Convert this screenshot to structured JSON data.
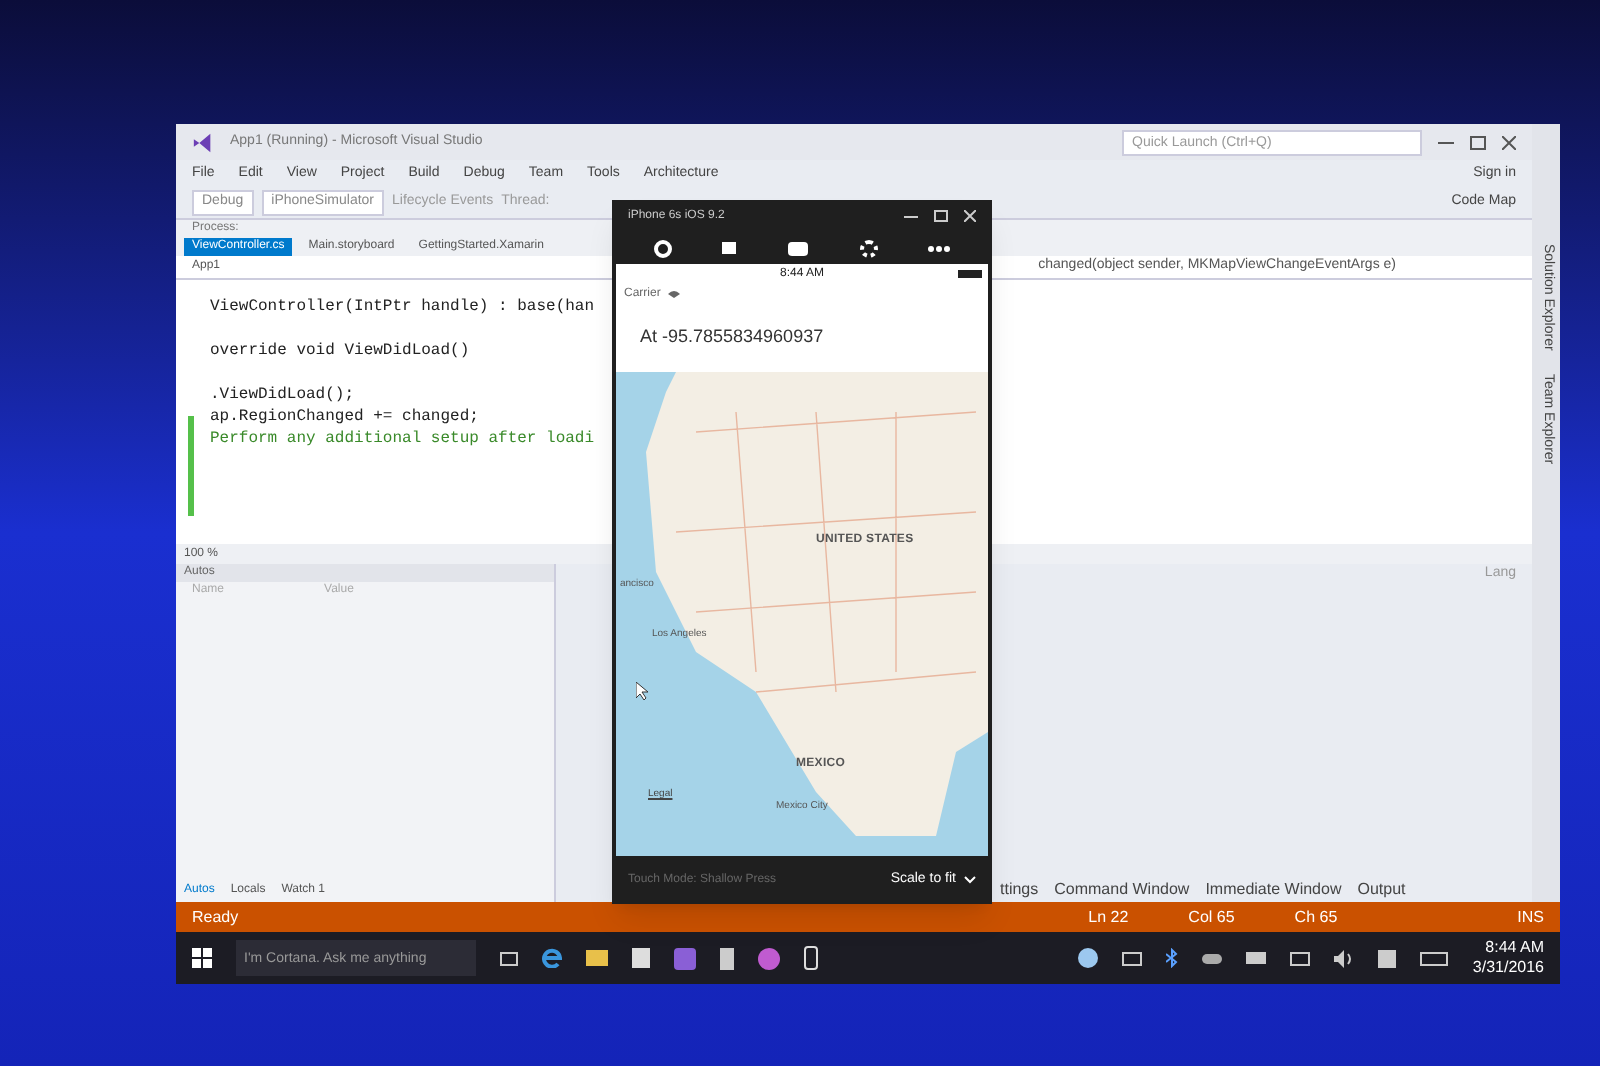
{
  "vs": {
    "title": "App1 (Running) - Microsoft Visual Studio",
    "quick_launch": {
      "placeholder": "Quick Launch (Ctrl+Q)"
    },
    "sign_in": "Sign in",
    "menu": [
      "File",
      "Edit",
      "View",
      "Project",
      "Build",
      "Debug",
      "Team",
      "Tools",
      "Architecture"
    ],
    "toolbar": {
      "configuration": "Debug",
      "platform": "iPhoneSimulator",
      "lifecycle": "Lifecycle Events",
      "thread": "Thread:",
      "process": "Process:",
      "code_map": "Code Map"
    },
    "tabs": [
      {
        "label": "ViewController.cs",
        "selected": true
      },
      {
        "label": "Main.storyboard",
        "selected": false
      },
      {
        "label": "GettingStarted.Xamarin",
        "selected": false
      }
    ],
    "nav": {
      "left": "App1",
      "right": "changed(object sender, MKMapViewChangeEventArgs e)"
    },
    "code": [
      {
        "kind": "plain",
        "text": "ViewController(IntPtr handle) : base(han"
      },
      {
        "kind": "blank"
      },
      {
        "kind": "plain",
        "text": "override void ViewDidLoad()"
      },
      {
        "kind": "blank"
      },
      {
        "kind": "plain",
        "text": ".ViewDidLoad();"
      },
      {
        "kind": "plain",
        "text": "ap.RegionChanged += changed;"
      },
      {
        "kind": "comment",
        "text": "Perform any additional setup after loadi"
      }
    ],
    "zoom": "100 %",
    "autos": {
      "title": "Autos",
      "columns": [
        "Name",
        "Value"
      ],
      "tabs": [
        {
          "label": "Autos",
          "selected": true
        },
        {
          "label": "Locals",
          "selected": false
        },
        {
          "label": "Watch 1",
          "selected": false
        }
      ]
    },
    "lower_right": {
      "label": "Lang",
      "tabs": [
        "ttings",
        "Command Window",
        "Immediate Window",
        "Output"
      ]
    },
    "side_tabs": [
      "Solution Explorer",
      "Team Explorer"
    ],
    "status": {
      "ready": "Ready",
      "line": "Ln 22",
      "col": "Col 65",
      "ch": "Ch 65",
      "mode": "INS"
    }
  },
  "simulator": {
    "title": "iPhone 6s iOS 9.2",
    "carrier": "Carrier",
    "time": "8:44 AM",
    "location": "At -95.7855834960937",
    "map_labels": [
      {
        "kind": "country",
        "text": "UNITED STATES"
      },
      {
        "kind": "city",
        "text": "ancisco"
      },
      {
        "kind": "city",
        "text": "Los Angeles"
      },
      {
        "kind": "country",
        "text": "MEXICO"
      },
      {
        "kind": "city",
        "text": "Mexico City"
      },
      {
        "kind": "legal",
        "text": "Legal"
      }
    ],
    "touch_mode": "Touch Mode: Shallow Press",
    "scale": "Scale to fit"
  },
  "taskbar": {
    "search": {
      "placeholder": "I'm Cortana. Ask me anything"
    },
    "time": "8:44 AM",
    "date": "3/31/2016"
  }
}
